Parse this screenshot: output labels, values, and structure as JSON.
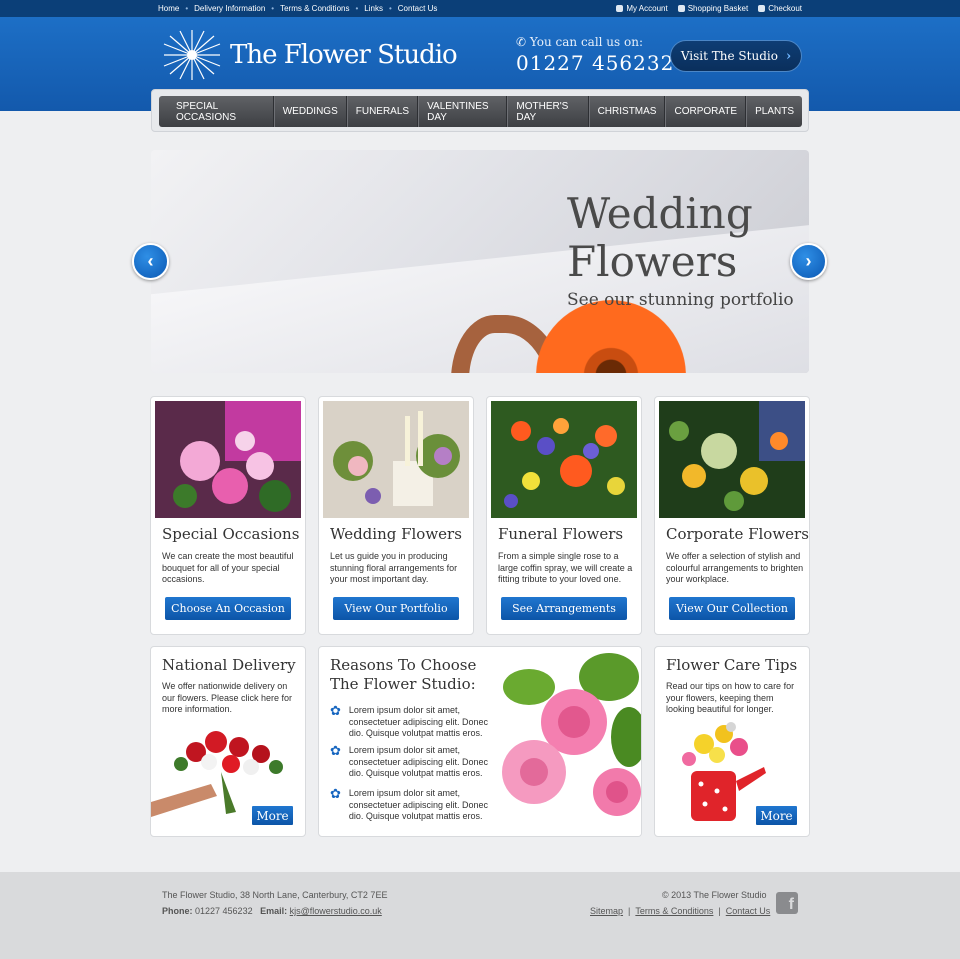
{
  "topbar": {
    "links": [
      "Home",
      "Delivery Information",
      "Terms & Conditions",
      "Links",
      "Contact Us"
    ],
    "account": [
      {
        "label": "My Account",
        "icon": "user-icon"
      },
      {
        "label": "Shopping Basket",
        "icon": "basket-icon"
      },
      {
        "label": "Checkout",
        "icon": "checkout-icon"
      }
    ]
  },
  "header": {
    "logo_text": "The Flower Studio",
    "call_label": "You can call us on:",
    "phone": "01227 456232",
    "visit_label": "Visit The Studio"
  },
  "nav": [
    "SPECIAL OCCASIONS",
    "WEDDINGS",
    "FUNERALS",
    "VALENTINES DAY",
    "MOTHER'S DAY",
    "CHRISTMAS",
    "CORPORATE",
    "PLANTS"
  ],
  "hero": {
    "title_line1": "Wedding",
    "title_line2": "Flowers",
    "subtitle": "See our stunning portfolio"
  },
  "cards": [
    {
      "title": "Special Occasions",
      "text": "We can create the most beautiful bouquet for all of your special occasions.",
      "button": "Choose An Occasion"
    },
    {
      "title": "Wedding Flowers",
      "text": "Let us guide you in producing stunning floral arrangements for your most important day.",
      "button": "View Our Portfolio"
    },
    {
      "title": "Funeral Flowers",
      "text": "From a simple single rose to a large coffin spray, we will create a fitting tribute to your loved one.",
      "button": "See Arrangements"
    },
    {
      "title": "Corporate Flowers",
      "text": "We offer a selection of stylish and colourful arrangements to brighten your workplace.",
      "button": "View Our Collection"
    }
  ],
  "delivery": {
    "title": "National Delivery",
    "text": "We offer nationwide delivery on our flowers. Please click here for more information.",
    "button": "More"
  },
  "reasons": {
    "title_line1": "Reasons To Choose",
    "title_line2": "The Flower Studio:",
    "items": [
      "Lorem ipsum dolor sit amet, consectetuer adipiscing elit. Donec dio. Quisque volutpat mattis eros.",
      "Lorem ipsum dolor sit amet, consectetuer adipiscing elit. Donec dio. Quisque volutpat mattis eros.",
      "Lorem ipsum dolor sit amet, consectetuer adipiscing elit. Donec dio. Quisque volutpat mattis eros."
    ]
  },
  "care": {
    "title": "Flower Care Tips",
    "text": "Read our tips on how to care for your flowers, keeping them looking beautiful for longer.",
    "button": "More"
  },
  "footer": {
    "address": "The Flower Studio, 38 North Lane, Canterbury, CT2 7EE",
    "phone_label": "Phone:",
    "phone": "01227 456232",
    "email_label": "Email:",
    "email": "kjs@flowerstudio.co.uk",
    "copyright": "© 2013 The Flower Studio",
    "links": [
      "Sitemap",
      "Terms & Conditions",
      "Contact Us"
    ],
    "social_icon": "facebook-icon"
  },
  "colors": {
    "brand_blue": "#1359ac",
    "topbar": "#0b3f78",
    "button_blue": "#0c55a8",
    "nav_dark": "#3d3f43"
  }
}
